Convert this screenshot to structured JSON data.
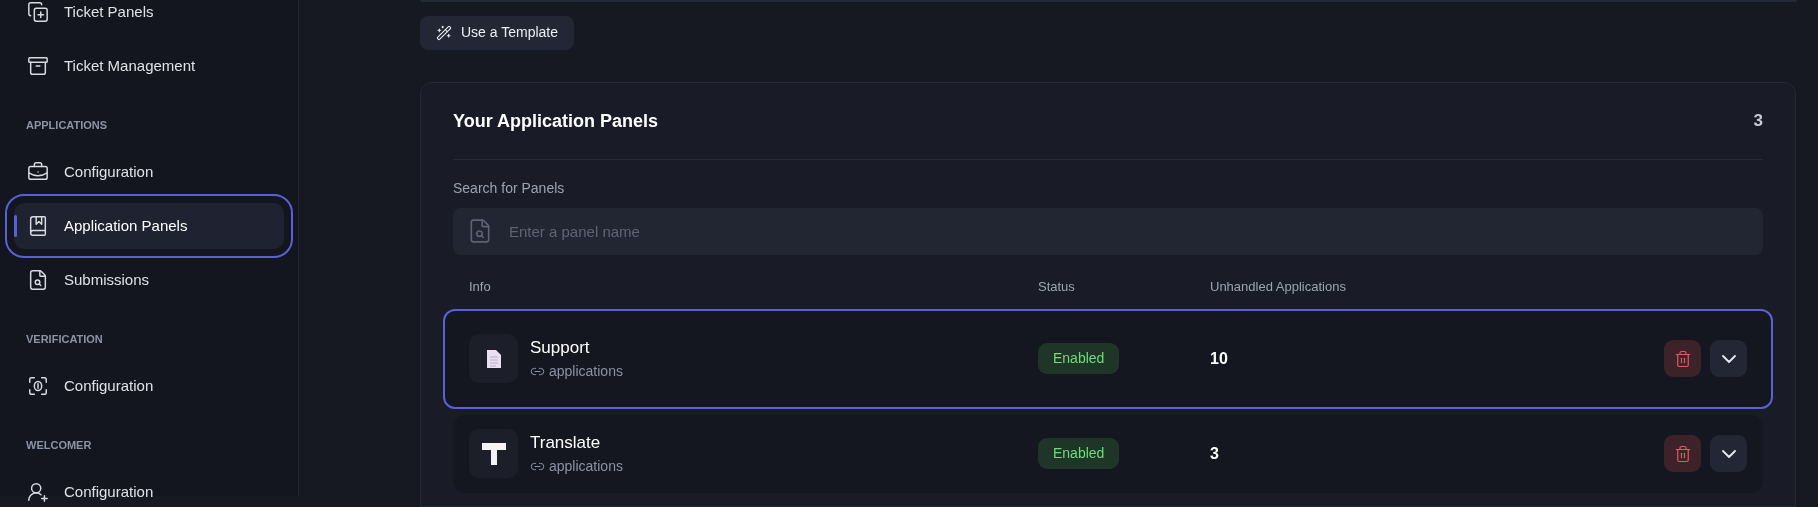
{
  "sidebar": {
    "groups": [
      {
        "items": [
          {
            "label": "Ticket Panels",
            "selected": false
          },
          {
            "label": "Ticket Management",
            "selected": false
          }
        ]
      },
      {
        "heading": "APPLICATIONS",
        "items": [
          {
            "label": "Configuration",
            "selected": false
          },
          {
            "label": "Application Panels",
            "selected": true
          },
          {
            "label": "Submissions",
            "selected": false
          }
        ]
      },
      {
        "heading": "VERIFICATION",
        "items": [
          {
            "label": "Configuration",
            "selected": false
          }
        ]
      },
      {
        "heading": "WELCOMER",
        "items": [
          {
            "label": "Configuration",
            "selected": false
          }
        ]
      }
    ]
  },
  "template_button": "Use a Template",
  "panel_card": {
    "title": "Your Application Panels",
    "count": "3",
    "search": {
      "label": "Search for Panels",
      "placeholder": "Enter a panel name"
    },
    "columns": [
      "Info",
      "Status",
      "Unhandled Applications"
    ],
    "rows": [
      {
        "name": "Support",
        "channel": "applications",
        "status": "Enabled",
        "enabled": true,
        "unhandled": "10",
        "selected": true
      },
      {
        "name": "Translate",
        "channel": "applications",
        "status": "Enabled",
        "enabled": true,
        "unhandled": "3",
        "selected": false
      }
    ]
  }
}
